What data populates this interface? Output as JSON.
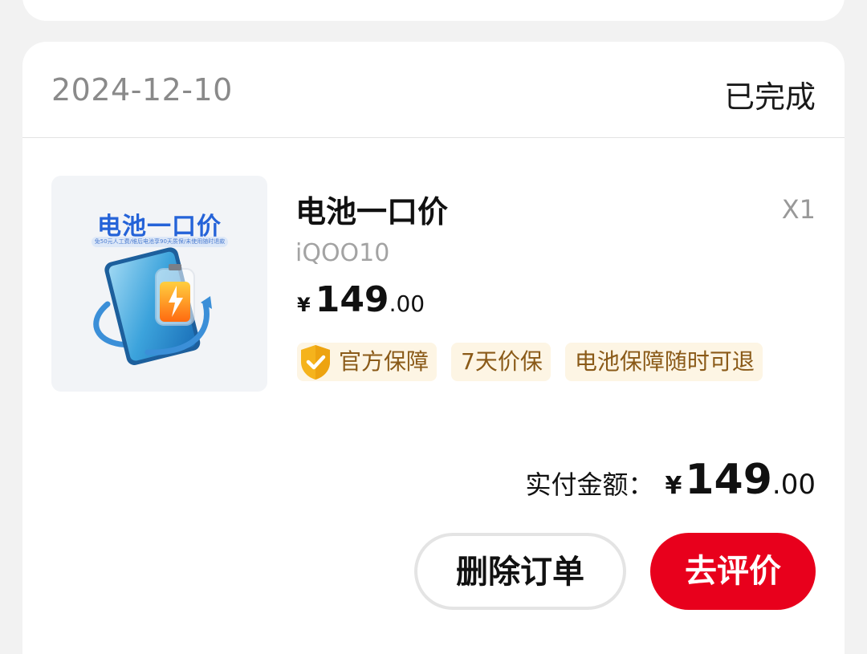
{
  "order": {
    "date": "2024-12-10",
    "status": "已完成"
  },
  "product": {
    "image_title": "电池一口价",
    "image_subtitle": "免50元人工费/维后电池享90天质保/未使用随时退款",
    "name": "电池一口价",
    "quantity": "X1",
    "model": "iQOO10",
    "price": {
      "currency": "¥",
      "integer": "149",
      "decimal": ".00"
    },
    "tags": [
      "官方保障",
      "7天价保",
      "电池保障随时可退"
    ],
    "tag_icon": "shield-check-icon"
  },
  "payment": {
    "label": "实付金额：",
    "currency": "¥",
    "integer": "149",
    "decimal": ".00"
  },
  "actions": {
    "delete_label": "删除订单",
    "review_label": "去评价"
  },
  "colors": {
    "accent": "#e8001c",
    "tag_bg": "#fdf5e4",
    "tag_text": "#8a5a18",
    "shield": "#f5b31c"
  }
}
